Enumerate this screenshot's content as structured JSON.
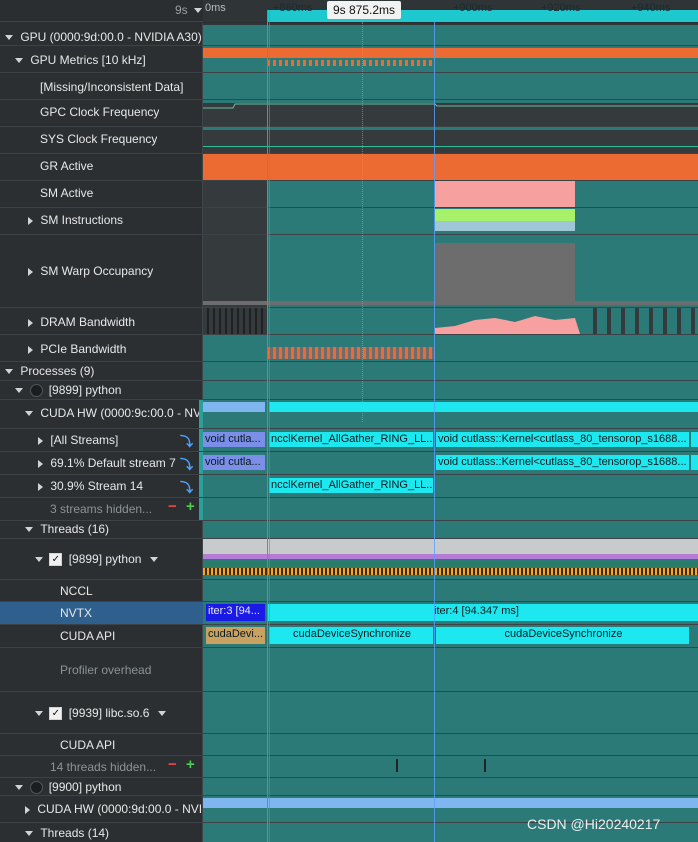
{
  "header": {
    "time_label": "9s",
    "ruler_ticks": [
      "0ms",
      "+860ms",
      "+900ms",
      "+920ms",
      "+940ms"
    ],
    "cursor_time": "9s 875.2ms"
  },
  "rows": {
    "gpu": "GPU (0000:9d:00.0 - NVIDIA A30)",
    "gpu_metrics": "GPU Metrics [10 kHz]",
    "missing": "[Missing/Inconsistent Data]",
    "gpc_clock": "GPC Clock Frequency",
    "sys_clock": "SYS Clock Frequency",
    "gr_active": "GR Active",
    "sm_active": "SM Active",
    "sm_instr": "SM Instructions",
    "sm_warp": "SM Warp Occupancy",
    "dram": "DRAM Bandwidth",
    "pcie": "PCIe Bandwidth",
    "processes": "Processes (9)",
    "proc1": "[9899] python",
    "cuda_hw1": "CUDA HW (0000:9c:00.0 - NV",
    "all_streams": "[All Streams]",
    "default_stream": "69.1% Default stream 7",
    "stream14": "30.9% Stream 14",
    "streams_hidden": "3 streams hidden...",
    "threads16": "Threads (16)",
    "thread_python": "[9899] python",
    "nccl": "NCCL",
    "nvtx": "NVTX",
    "cuda_api": "CUDA API",
    "profiler_overhead": "Profiler overhead",
    "thread_libc": "[9939] libc.so.6",
    "cuda_api2": "CUDA API",
    "threads_hidden": "14 threads hidden...",
    "proc2": "[9900] python",
    "cuda_hw2": "CUDA HW (0000:9d:00.0 - NVI",
    "threads14": "Threads (14)"
  },
  "bars": {
    "all_left": "void cutla...",
    "all_mid": "ncclKernel_AllGather_RING_LL...",
    "all_right": "void cutlass::Kernel<cutlass_80_tensorop_s1688...",
    "def_left": "void cutla...",
    "def_right": "void cutlass::Kernel<cutlass_80_tensorop_s1688...",
    "s14_mid": "ncclKernel_AllGather_RING_LL...",
    "nvtx_left": "iter:3 [94...",
    "nvtx_right": "iter:4 [94.347 ms]",
    "api_left": "cudaDevi...",
    "api_mid": "cudaDeviceSynchronize",
    "api_right": "cudaDeviceSynchronize"
  },
  "watermark": "CSDN @Hi20240217",
  "colors": {
    "teal_track": "#2b7a78",
    "cyan_bar": "#1de8ef",
    "orange": "#ec6b32",
    "pink": "#f6a0a0",
    "green": "#a7f06a",
    "grey_fill": "#6d6d6d",
    "nvtx_blue": "#1a1ae6",
    "selection": "#2f5f8c"
  }
}
